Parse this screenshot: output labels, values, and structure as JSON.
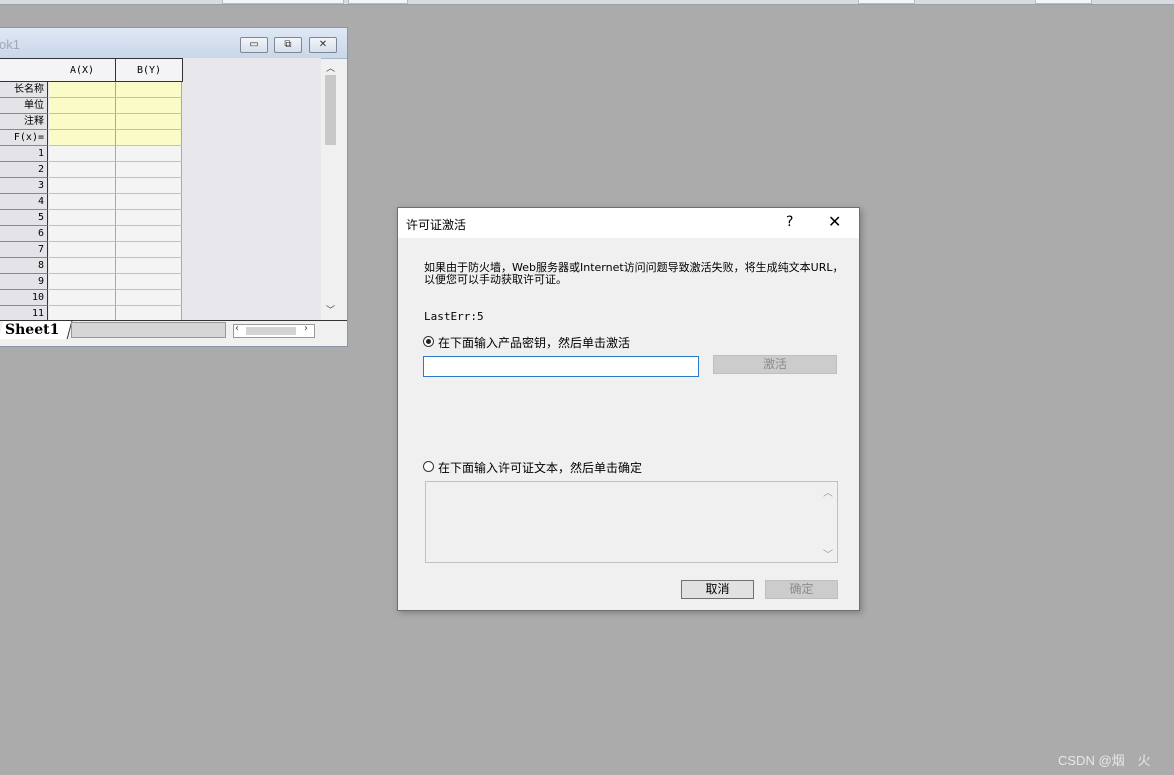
{
  "workbook": {
    "title": "ok1",
    "buttons": {
      "minimize": "▭",
      "restore": "⧉",
      "close": "✕"
    },
    "columns": [
      "A(X)",
      "B(Y)"
    ],
    "header_rows": [
      "长名称",
      "单位",
      "注释",
      "F(x)="
    ],
    "rows": [
      "1",
      "2",
      "3",
      "4",
      "5",
      "6",
      "7",
      "8",
      "9",
      "10",
      "11"
    ],
    "sheet_tab": "Sheet1"
  },
  "dialog": {
    "title": "许可证激活",
    "help": "?",
    "close": "✕",
    "message": "如果由于防火墙，Web服务器或Internet访问问题导致激活失败，将生成纯文本URL，以便您可以手动获取许可证。",
    "last_error": "LastErr:5",
    "option_key": {
      "label": "在下面输入产品密钥，然后单击激活",
      "selected": true
    },
    "key_input": {
      "value": "",
      "placeholder": ""
    },
    "activate_button": "激活",
    "option_text": {
      "label": "在下面输入许可证文本，然后单击确定",
      "selected": false
    },
    "cancel_button": "取消",
    "ok_button": "确定"
  },
  "watermark": "CSDN @烟　火"
}
